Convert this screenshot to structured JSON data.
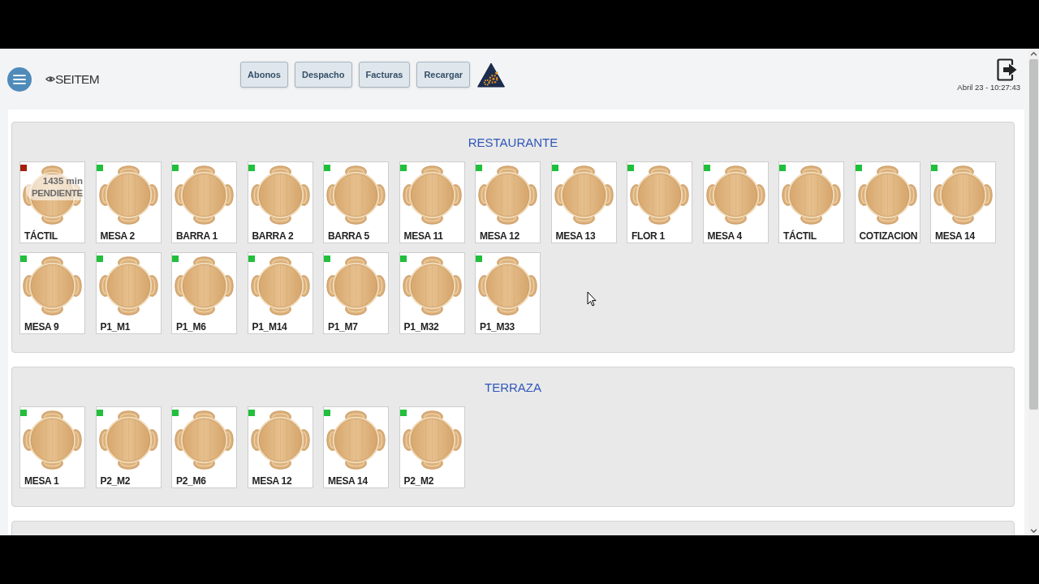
{
  "header": {
    "logo": "SEITEM",
    "buttons": [
      "Abonos",
      "Despacho",
      "Facturas",
      "Recargar"
    ],
    "datetime": "Abril 23 - 10:27:43"
  },
  "sections": [
    {
      "title": "RESTAURANTE",
      "tables": [
        {
          "name": "TÁCTIL",
          "color": "#a3210f",
          "elapsed": "1435 min",
          "status": "PENDIENTE"
        },
        {
          "name": "MESA 2",
          "color": "#22bf3c"
        },
        {
          "name": "BARRA 1",
          "color": "#22bf3c"
        },
        {
          "name": "BARRA 2",
          "color": "#22bf3c"
        },
        {
          "name": "BARRA 5",
          "color": "#22bf3c"
        },
        {
          "name": "MESA 11",
          "color": "#22bf3c"
        },
        {
          "name": "MESA 12",
          "color": "#22bf3c"
        },
        {
          "name": "MESA 13",
          "color": "#22bf3c"
        },
        {
          "name": "FLOR 1",
          "color": "#22bf3c"
        },
        {
          "name": "MESA 4",
          "color": "#22bf3c"
        },
        {
          "name": "TÁCTIL",
          "color": "#22bf3c"
        },
        {
          "name": "COTIZACION",
          "color": "#22bf3c"
        },
        {
          "name": "MESA 14",
          "color": "#22bf3c"
        },
        {
          "name": "MESA 9",
          "color": "#22bf3c"
        },
        {
          "name": "P1_M1",
          "color": "#22bf3c"
        },
        {
          "name": "P1_M6",
          "color": "#22bf3c"
        },
        {
          "name": "P1_M14",
          "color": "#22bf3c"
        },
        {
          "name": "P1_M7",
          "color": "#22bf3c"
        },
        {
          "name": "P1_M32",
          "color": "#22bf3c"
        },
        {
          "name": "P1_M33",
          "color": "#22bf3c"
        }
      ]
    },
    {
      "title": "TERRAZA",
      "tables": [
        {
          "name": "MESA 1",
          "color": "#22bf3c"
        },
        {
          "name": "P2_M2",
          "color": "#22bf3c"
        },
        {
          "name": "P2_M6",
          "color": "#22bf3c"
        },
        {
          "name": "MESA 12",
          "color": "#22bf3c"
        },
        {
          "name": "MESA 14",
          "color": "#22bf3c"
        },
        {
          "name": "P2_M2",
          "color": "#22bf3c"
        }
      ]
    }
  ]
}
